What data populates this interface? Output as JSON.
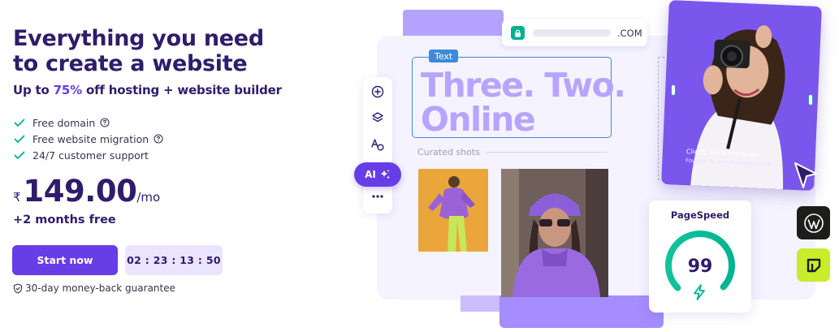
{
  "hero": {
    "title": "Everything you need to create a website",
    "subtitle_prefix": "Up to ",
    "subtitle_discount": "75%",
    "subtitle_suffix": " off hosting + website builder",
    "features": [
      {
        "label": "Free domain",
        "has_help": true
      },
      {
        "label": "Free website migration",
        "has_help": true
      },
      {
        "label": "24/7 customer support",
        "has_help": false
      }
    ],
    "currency": "₹",
    "price": "149.00",
    "period": "/mo",
    "bonus": "+2 months free",
    "cta_label": "Start now",
    "countdown": "02 : 23 : 13 : 50",
    "guarantee": "30-day money-back guarantee"
  },
  "mockup": {
    "url_tld": ".COM",
    "text_tag": "Text",
    "headline_line1": "Three. Two.",
    "headline_line2": "Online",
    "curated_label": "Curated shots",
    "toolbar_icons": [
      "plus-circle-icon",
      "layers-icon",
      "translate-icon",
      "more-icon"
    ],
    "ai_label": "AI",
    "client_name": "Client: Anna Franques",
    "client_role": "Founder of annafranques.com",
    "pagespeed_title": "PageSpeed",
    "pagespeed_score": "99",
    "pagespeed_fraction": 0.99
  },
  "colors": {
    "brand_purple": "#673de6",
    "heading_navy": "#2f1c6a",
    "check_green": "#00b090",
    "headline_lilac": "#b7a4ff",
    "lime": "#c9ec2b"
  }
}
